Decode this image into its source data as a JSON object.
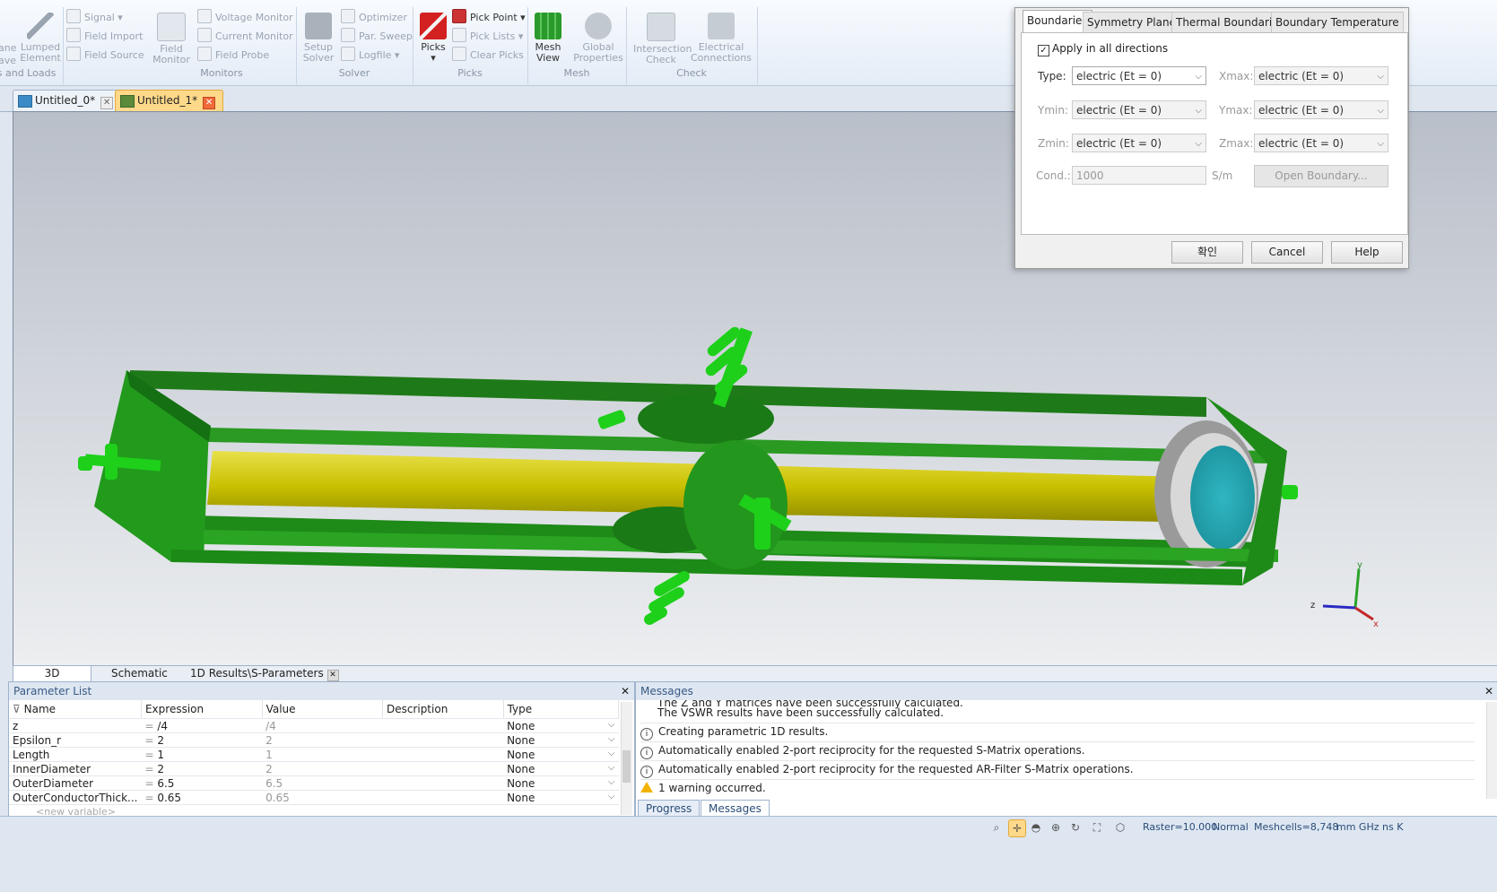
{
  "ribbon": {
    "left_partial": {
      "line1": "ane",
      "line2": "ave",
      "lumped": "Lumped Element",
      "group": "es and Loads"
    },
    "sources": {
      "signal": "Signal",
      "field_import": "Field Import",
      "field_source": "Field Source"
    },
    "monitors": {
      "field_monitor": "Field Monitor",
      "voltage_monitor": "Voltage Monitor",
      "current_monitor": "Current Monitor",
      "field_probe": "Field Probe",
      "group": "Monitors"
    },
    "solver": {
      "setup_solver": "Setup Solver",
      "optimizer": "Optimizer",
      "par_sweep": "Par. Sweep",
      "logfile": "Logfile",
      "group": "Solver"
    },
    "picks": {
      "picks": "Picks",
      "pick_point": "Pick Point",
      "pick_lists": "Pick Lists",
      "clear_picks": "Clear Picks",
      "group": "Picks"
    },
    "mesh": {
      "mesh_view": "Mesh View",
      "global_properties": "Global Properties",
      "group": "Mesh"
    },
    "check": {
      "intersection_check": "Intersection Check",
      "electrical_connections": "Electrical Connections",
      "group": "Check"
    }
  },
  "doc_tabs": [
    {
      "label": "Untitled_0*",
      "active": false
    },
    {
      "label": "Untitled_1*",
      "active": true
    }
  ],
  "view_tabs": [
    "3D",
    "Schematic",
    "1D Results\\S-Parameters"
  ],
  "param_panel": {
    "title": "Parameter List",
    "headers": [
      "Name",
      "Expression",
      "Value",
      "Description",
      "Type"
    ],
    "rows": [
      {
        "name": "z",
        "expr": "/4",
        "value": "/4",
        "desc": "",
        "type": "None"
      },
      {
        "name": "Epsilon_r",
        "expr": "2",
        "value": "2",
        "desc": "",
        "type": "None"
      },
      {
        "name": "Length",
        "expr": "1",
        "value": "1",
        "desc": "",
        "type": "None"
      },
      {
        "name": "InnerDiameter",
        "expr": "2",
        "value": "2",
        "desc": "",
        "type": "None"
      },
      {
        "name": "OuterDiameter",
        "expr": "6.5",
        "value": "6.5",
        "desc": "",
        "type": "None"
      },
      {
        "name": "OuterConductorThick...",
        "expr": "0.65",
        "value": "0.65",
        "desc": "",
        "type": "None"
      }
    ],
    "new_variable": "<new variable>"
  },
  "messages_panel": {
    "title": "Messages",
    "lines": [
      {
        "icon": "",
        "text": "The Z and Y matrices have been successfully calculated."
      },
      {
        "icon": "",
        "text": "The VSWR results have been successfully calculated."
      },
      {
        "icon": "info",
        "text": "Creating parametric 1D results."
      },
      {
        "icon": "info",
        "text": "Automatically enabled 2-port reciprocity for the requested S-Matrix operations."
      },
      {
        "icon": "info",
        "text": "Automatically enabled 2-port reciprocity for the requested AR-Filter S-Matrix operations."
      },
      {
        "icon": "warning",
        "text": "1 warning occurred."
      }
    ],
    "tabs": [
      "Progress",
      "Messages"
    ]
  },
  "status": {
    "raster": "Raster=10.000",
    "mode": "Normal",
    "meshcells": "Meshcells=8,748",
    "units": "mm GHz ns K"
  },
  "dialog": {
    "tabs": [
      "Boundaries",
      "Symmetry Planes",
      "Thermal Boundaries",
      "Boundary Temperature"
    ],
    "apply_all": "Apply in all directions",
    "labels": {
      "type": "Type:",
      "xmax": "Xmax:",
      "ymin": "Ymin:",
      "ymax": "Ymax:",
      "zmin": "Zmin:",
      "zmax": "Zmax:",
      "cond": "Cond.:",
      "unit": "S/m"
    },
    "values": {
      "type": "electric (Et = 0)",
      "xmax": "electric (Et = 0)",
      "ymin": "electric (Et = 0)",
      "ymax": "electric (Et = 0)",
      "zmin": "electric (Et = 0)",
      "zmax": "electric (Et = 0)",
      "cond": "1000"
    },
    "open_boundary": "Open Boundary...",
    "ok": "확인",
    "cancel": "Cancel",
    "help": "Help"
  },
  "axes": {
    "x": "x",
    "y": "y",
    "z": "z"
  },
  "colors": {
    "model_green": "#1e8f1a",
    "conductor_yellow": "#c8c000",
    "port_cyan": "#2fb7c2"
  }
}
